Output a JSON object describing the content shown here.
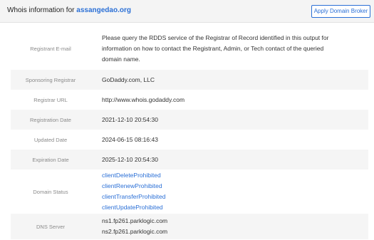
{
  "header": {
    "title_prefix": "Whois information for",
    "domain": "assangedao.org",
    "broker_button": "Apply Domain Broker"
  },
  "rows": {
    "registrant_email": {
      "label": "Registrant E-mail",
      "value": "Please query the RDDS service of the Registrar of Record identified in this output for information on how to contact the Registrant, Admin, or Tech contact of the queried domain name."
    },
    "sponsoring_registrar": {
      "label": "Sponsoring Registrar",
      "value": "GoDaddy.com, LLC"
    },
    "registrar_url": {
      "label": "Registrar URL",
      "value": "http://www.whois.godaddy.com"
    },
    "registration_date": {
      "label": "Registration Date",
      "value": "2021-12-10 20:54:30"
    },
    "updated_date": {
      "label": "Updated Date",
      "value": "2024-06-15 08:16:43"
    },
    "expiration_date": {
      "label": "Expiration Date",
      "value": "2025-12-10 20:54:30"
    },
    "domain_status": {
      "label": "Domain Status",
      "values": [
        "clientDeleteProhibited",
        "clientRenewProhibited",
        "clientTransferProhibited",
        "clientUpdateProhibited"
      ]
    },
    "dns_server": {
      "label": "DNS Server",
      "values": [
        "ns1.fp261.parklogic.com",
        "ns2.fp261.parklogic.com"
      ]
    }
  },
  "colors": {
    "link": "#2a6fd6",
    "header_bg": "#f4f4f4",
    "alt_row_bg": "#f5f5f5"
  }
}
